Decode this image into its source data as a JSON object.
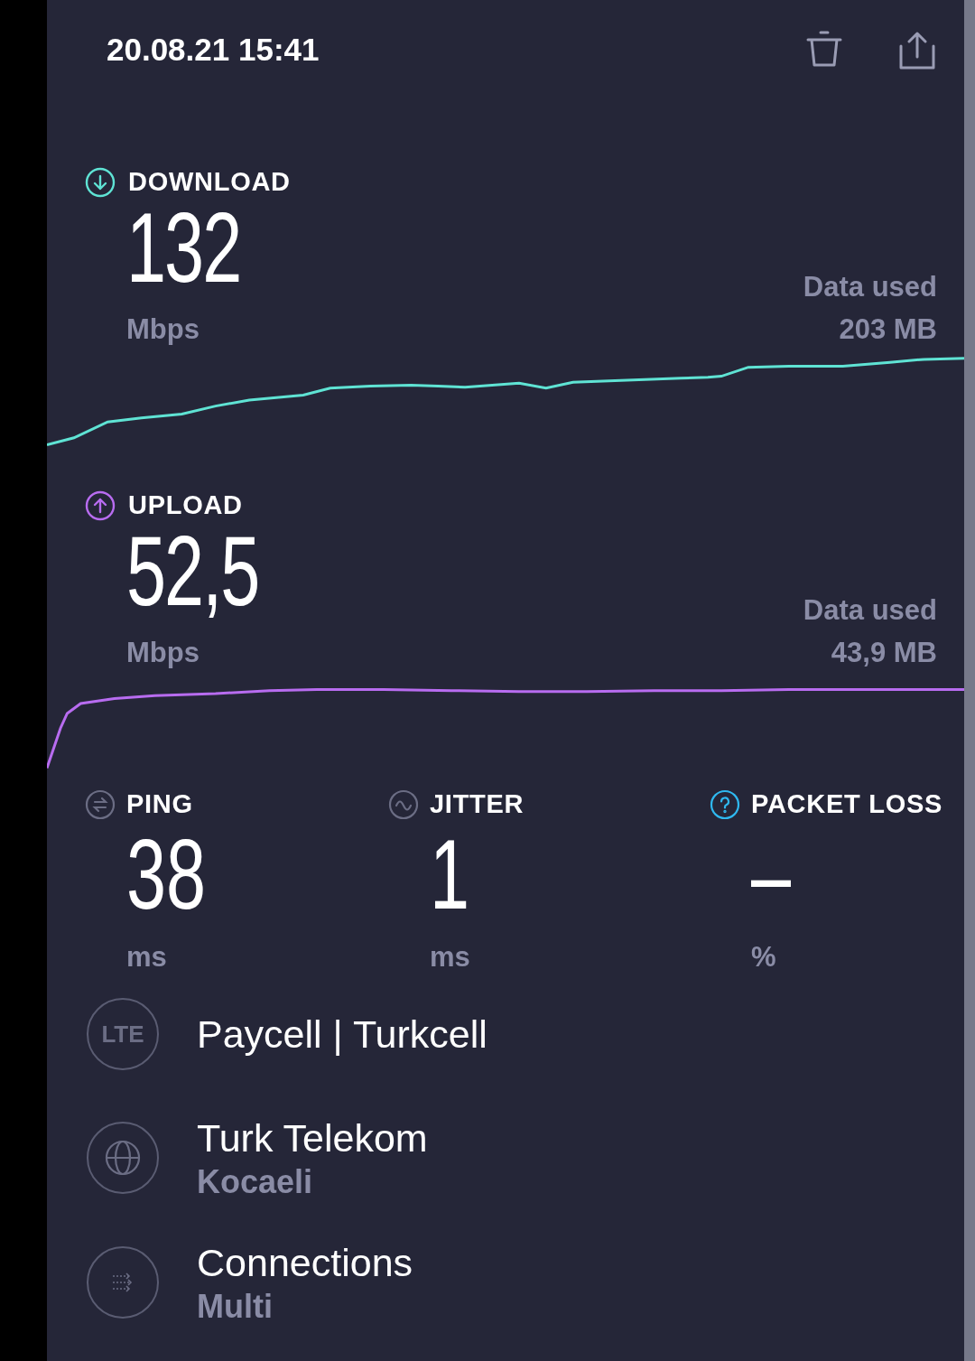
{
  "header": {
    "timestamp": "20.08.21 15:41"
  },
  "speeds": [
    {
      "kind": "download",
      "label": "DOWNLOAD",
      "value": "132",
      "unit": "Mbps",
      "data_used_label": "Data used",
      "data_used": "203 MB",
      "color": "#5fe3d4"
    },
    {
      "kind": "upload",
      "label": "UPLOAD",
      "value": "52,5",
      "unit": "Mbps",
      "data_used_label": "Data used",
      "data_used": "43,9 MB",
      "color": "#b86cf0"
    }
  ],
  "stats": [
    {
      "kind": "ping",
      "label": "PING",
      "value": "38",
      "unit": "ms"
    },
    {
      "kind": "jitter",
      "label": "JITTER",
      "value": "1",
      "unit": "ms"
    },
    {
      "kind": "packet_loss",
      "label": "PACKET LOSS",
      "value": "–",
      "unit": "%"
    }
  ],
  "details": [
    {
      "kind": "network",
      "badge": "LTE",
      "title": "Paycell | Turkcell"
    },
    {
      "kind": "server",
      "title": "Turk Telekom",
      "subtitle": "Kocaeli"
    },
    {
      "kind": "connections",
      "title": "Connections",
      "subtitle": "Multi"
    }
  ]
}
